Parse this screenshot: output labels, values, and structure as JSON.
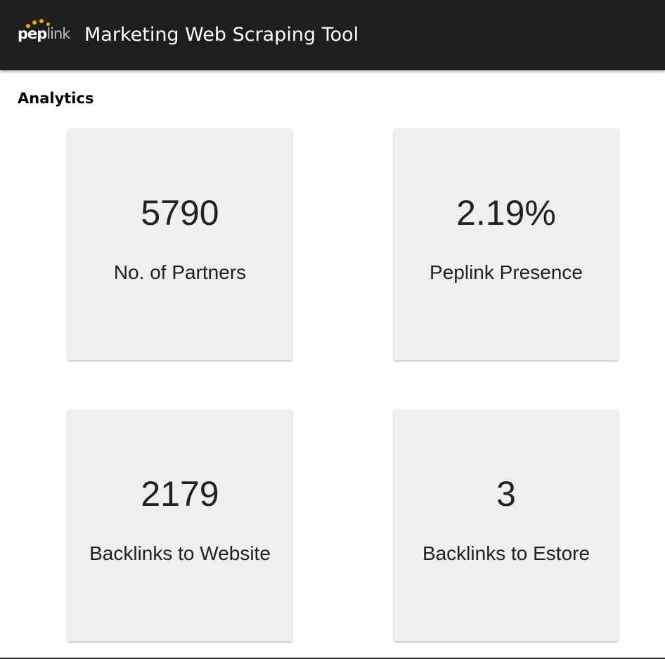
{
  "header": {
    "logo": {
      "text_part1": "pep",
      "text_part2": "link",
      "dot_color": "#f5a800"
    },
    "title": "Marketing Web Scraping Tool",
    "background": "#1e1e1e"
  },
  "analytics": {
    "heading": "Analytics",
    "cards": [
      {
        "value": "5790",
        "label": "No. of Partners"
      },
      {
        "value": "2.19%",
        "label": "Peplink Presence"
      },
      {
        "value": "2179",
        "label": "Backlinks to Website"
      },
      {
        "value": "3",
        "label": "Backlinks to Estore"
      }
    ]
  }
}
